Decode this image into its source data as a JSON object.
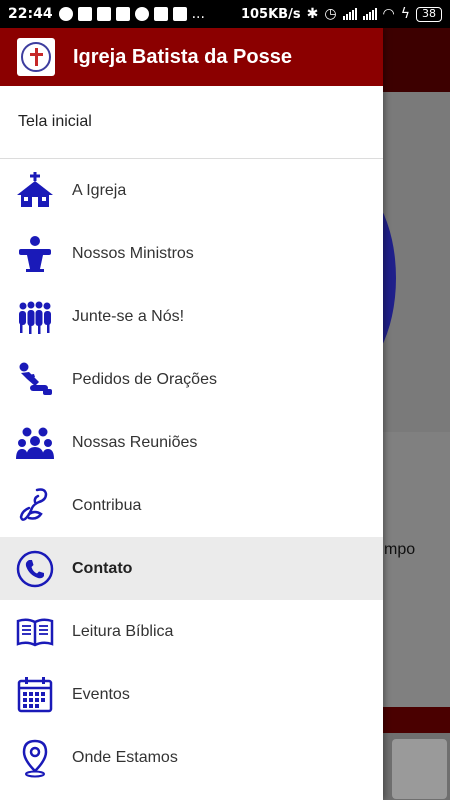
{
  "status_bar": {
    "time": "22:44",
    "speed": "105KB/s",
    "battery": "38",
    "dots": "..."
  },
  "drawer": {
    "app_title": "Igreja Batista da Posse",
    "home_label": "Tela inicial",
    "items": [
      {
        "label": "A Igreja",
        "icon": "church-icon"
      },
      {
        "label": "Nossos Ministros",
        "icon": "pulpit-icon"
      },
      {
        "label": "Junte-se a Nós!",
        "icon": "group-people-icon"
      },
      {
        "label": "Pedidos de Orações",
        "icon": "kneeling-prayer-icon"
      },
      {
        "label": "Nossas Reuniões",
        "icon": "meeting-people-icon"
      },
      {
        "label": "Contribua",
        "icon": "offering-icon"
      },
      {
        "label": "Contato",
        "icon": "phone-icon"
      },
      {
        "label": "Leitura Bíblica",
        "icon": "open-book-icon"
      },
      {
        "label": "Eventos",
        "icon": "calendar-icon"
      },
      {
        "label": "Onde Estamos",
        "icon": "location-pin-icon"
      }
    ],
    "active_item": "Contato"
  },
  "background": {
    "partial_text": "mpo"
  },
  "colors": {
    "header": "#8b0000",
    "icon": "#1a1ab8",
    "active_row": "#ebebeb"
  }
}
